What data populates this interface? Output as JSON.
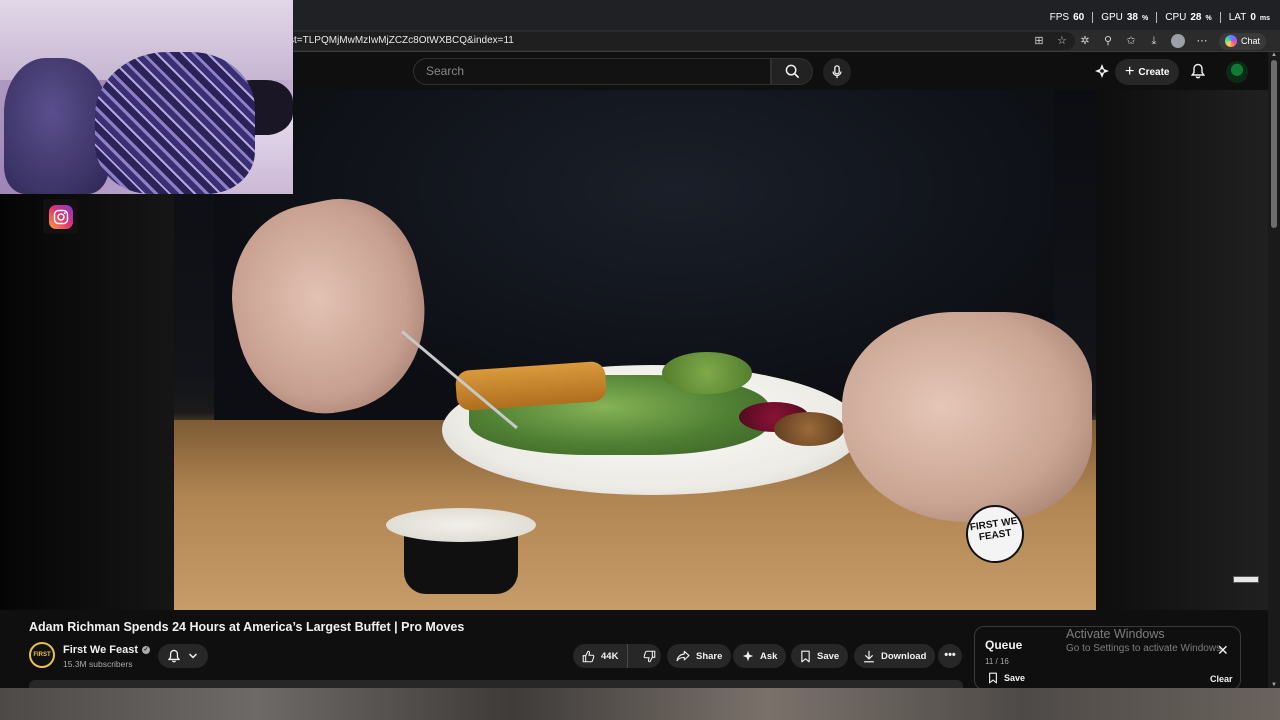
{
  "perf": {
    "fps_label": "FPS",
    "fps_value": "60",
    "gpu_label": "GPU",
    "gpu_value": "38",
    "gpu_unit": "%",
    "cpu_label": "CPU",
    "cpu_value": "28",
    "cpu_unit": "%",
    "lat_label": "LAT",
    "lat_value": "0",
    "lat_unit": "ms"
  },
  "browser": {
    "url_fragment": "st=TLPQMjMwMzIwMjZCZc8OtWXBCQ&index=11",
    "copilot_label": "Chat"
  },
  "header": {
    "search_placeholder": "Search",
    "create_label": "Create"
  },
  "video": {
    "logo_text": "FIRST WE FEAST",
    "title": "Adam Richman Spends 24 Hours at America’s Largest Buffet | Pro Moves"
  },
  "channel": {
    "name": "First We Feast",
    "subscribers": "15.3M subscribers",
    "avatar_text": "FIRST"
  },
  "actions": {
    "likes": "44K",
    "share": "Share",
    "ask": "Ask",
    "save": "Save",
    "download": "Download",
    "more": "•••"
  },
  "queue": {
    "title": "Queue",
    "count": "11 / 16",
    "save": "Save",
    "clear": "Clear",
    "close": "✕"
  },
  "windows_notice": {
    "title": "Activate Windows",
    "subtitle": "Go to Settings to activate Windows."
  },
  "colors": {
    "background": "#0f0f0f",
    "button_bg": "#272727",
    "text_primary": "#f1f1f1",
    "text_secondary": "#aaaaaa"
  },
  "icons": [
    "instagram-icon",
    "search-icon",
    "mic-icon",
    "bell-icon",
    "like-icon",
    "dislike-icon",
    "share-icon",
    "ask-icon",
    "save-icon",
    "download-icon",
    "close-icon"
  ]
}
